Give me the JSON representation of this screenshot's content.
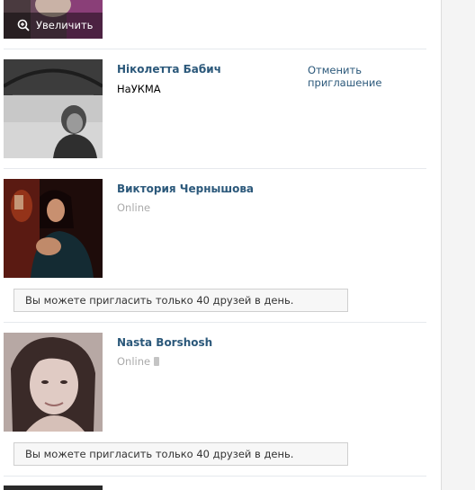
{
  "top_card": {
    "zoom_label": "Увеличить",
    "zoom_icon": "zoom-in-icon"
  },
  "friends": [
    {
      "name": "Ніколетта Бабич",
      "subtitle": "НаУКМА",
      "action": "Отменить приглашение"
    },
    {
      "name": "Виктория Чернышова",
      "status": "Online",
      "notice": "Вы можете пригласить только 40 друзей в день."
    },
    {
      "name": "Nasta Borshosh",
      "status": "Online",
      "status_icon": "mobile-phone-icon",
      "notice": "Вы можете пригласить только 40 друзей в день."
    }
  ],
  "colors": {
    "link": "#2b587a",
    "muted": "#aaaaaa",
    "separator": "#e6e9ed"
  }
}
